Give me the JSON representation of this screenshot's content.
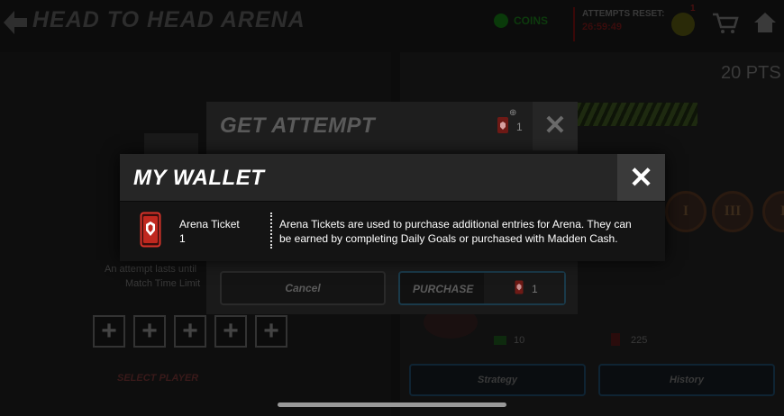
{
  "header": {
    "title": "HEAD TO HEAD ARENA",
    "coins_label": "COINS",
    "attempts_reset_label": "ATTEMPTS RESET:",
    "attempts_reset_value": "26:59:49",
    "notification_badge": "1"
  },
  "points": "20 PTS",
  "left_panel": {
    "info_line1": "An attempt lasts until",
    "info_line2": "Match Time Limit",
    "slot_symbol": "+",
    "select_button": "SELECT PLAYER"
  },
  "right_panel": {
    "badges": [
      "I",
      "III",
      "I"
    ],
    "cost_cash": "10",
    "cost_tickets": "225",
    "strategy_button": "Strategy",
    "history_button": "History"
  },
  "get_attempt": {
    "title": "GET ATTEMPT",
    "ticket_count": "1",
    "close_symbol": "✕",
    "cancel_label": "Cancel",
    "purchase_label": "PURCHASE",
    "purchase_cost": "1"
  },
  "my_wallet": {
    "title": "MY WALLET",
    "close_symbol": "✕",
    "item_name": "Arena Ticket",
    "item_count": "1",
    "item_description": "Arena Tickets are used to purchase additional entries for Arena. They can be earned by completing Daily Goals or purchased with Madden Cash."
  },
  "colors": {
    "ticket_red": "#d8332a",
    "modal_header": "#262626",
    "purchase_border": "#1a3a4a"
  }
}
